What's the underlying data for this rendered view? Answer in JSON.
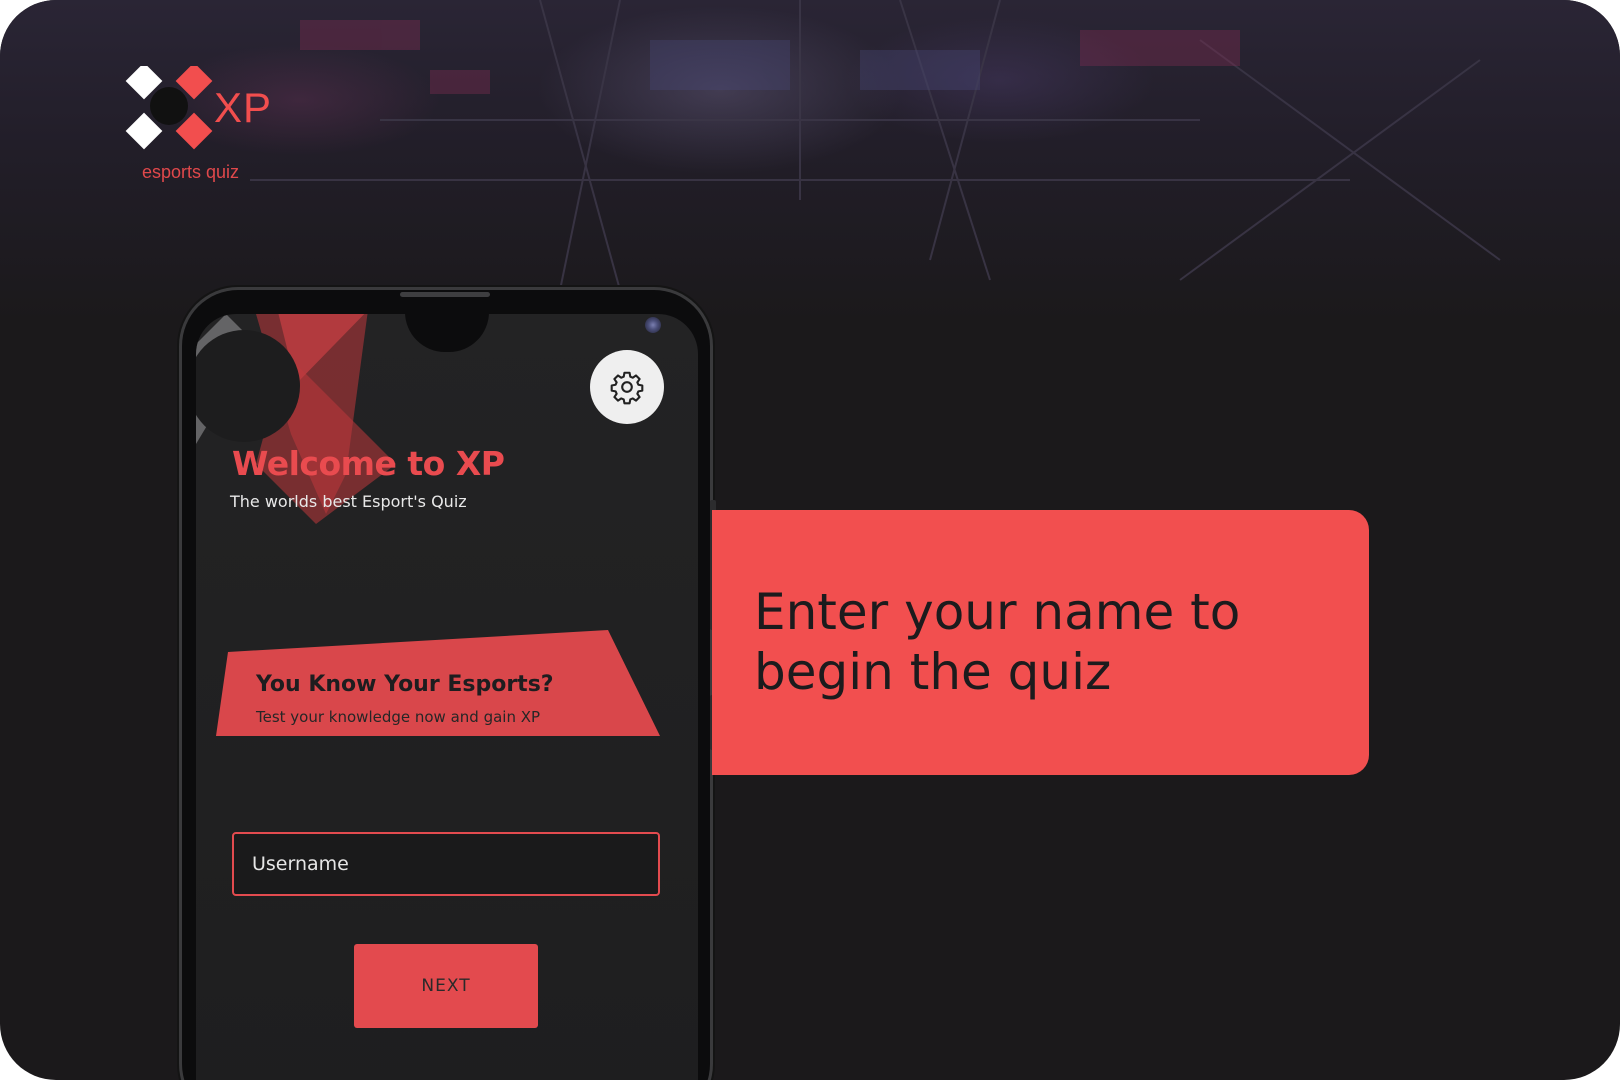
{
  "brand": {
    "logo_text": "XP",
    "tagline": "esports quiz",
    "accent_color": "#f24e4e"
  },
  "phone_screen": {
    "settings_icon": "gear-icon",
    "welcome_title": "Welcome to XP",
    "welcome_subtitle": "The worlds best Esport's Quiz",
    "banner": {
      "title": "You Know Your Esports?",
      "subtitle": "Test your knowledge now and gain XP"
    },
    "username": {
      "placeholder": "Username",
      "value": ""
    },
    "next_label": "NEXT"
  },
  "callout": {
    "text": "Enter your name to begin the quiz",
    "color": "#f24f4f"
  },
  "colors": {
    "background": "#1b191b",
    "screen": "#202021",
    "button": "#e34a4e"
  }
}
